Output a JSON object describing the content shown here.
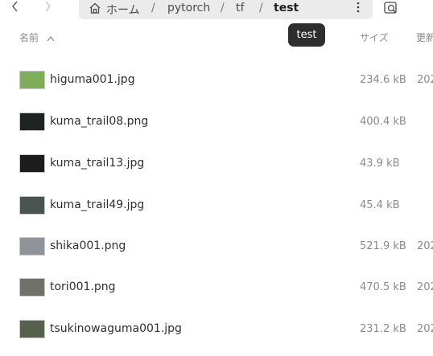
{
  "nav": {
    "back_icon": "chevron-left-icon",
    "forward_icon": "chevron-right-icon"
  },
  "path": {
    "home_label": "ホーム",
    "segments": [
      "pytorch",
      "tf",
      "test"
    ],
    "separator": "/"
  },
  "tooltip": "test",
  "columns": {
    "name": "名前",
    "size": "サイズ",
    "modified": "更新"
  },
  "files": [
    {
      "name": "higuma001.jpg",
      "size": "234.6 kB",
      "modified": "202",
      "thumb_color": "#7fae5a"
    },
    {
      "name": "kuma_trail08.png",
      "size": "400.4 kB",
      "modified": "",
      "thumb_color": "#1e2420"
    },
    {
      "name": "kuma_trail13.jpg",
      "size": "43.9 kB",
      "modified": "",
      "thumb_color": "#1a1d1b"
    },
    {
      "name": "kuma_trail49.jpg",
      "size": "45.4 kB",
      "modified": "",
      "thumb_color": "#4b5550"
    },
    {
      "name": "shika001.png",
      "size": "521.9 kB",
      "modified": "202",
      "thumb_color": "#8e949a"
    },
    {
      "name": "tori001.png",
      "size": "470.5 kB",
      "modified": "202",
      "thumb_color": "#6e7268"
    },
    {
      "name": "tsukinowaguma001.jpg",
      "size": "231.2 kB",
      "modified": "202",
      "thumb_color": "#55614d"
    }
  ]
}
